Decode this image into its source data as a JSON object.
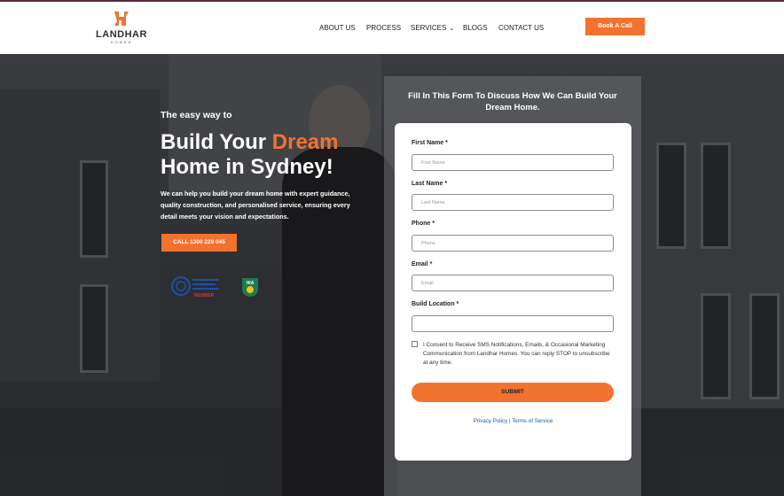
{
  "brand": {
    "name": "LANDHAR",
    "sub": "HOMES",
    "accent": "#f27230"
  },
  "nav": {
    "items": [
      "ABOUT US",
      "PROCESS",
      "SERVICES",
      "BLOGS",
      "CONTACT US"
    ],
    "services_icon": "chevron-down-icon",
    "cta": "Book A Call"
  },
  "hero": {
    "eyebrow": "The easy way to",
    "headline_part1": "Build Your ",
    "headline_highlight": "Dream",
    "headline_part2": "Home in Sydney!",
    "lead": "We can help you build your dream home with expert guidance, quality construction, and personalised service, ensuring every detail meets your vision and expectations.",
    "call_button": "CALL 1300 229 045",
    "badge_member": "MEMBER",
    "badge_hia": "HIA"
  },
  "form": {
    "heading": "Fill In This Form To Discuss How We Can Build Your Dream Home.",
    "first_name_label": "First Name *",
    "first_name_placeholder": "First Name",
    "last_name_label": "Last Name *",
    "last_name_placeholder": "Last Name",
    "phone_label": "Phone *",
    "phone_placeholder": "Phone",
    "email_label": "Email *",
    "email_placeholder": "Email",
    "location_label": "Build Location *",
    "location_placeholder": "",
    "consent": "I Consent to Receive SMS Notifications, Emails, & Occasional Marketing Communication from Landhar Homes. You can reply STOP to unsubscribe at any time.",
    "submit": "SUBMIT",
    "privacy": "Privacy Policy",
    "separator": "|",
    "terms": "Terms of Service"
  }
}
